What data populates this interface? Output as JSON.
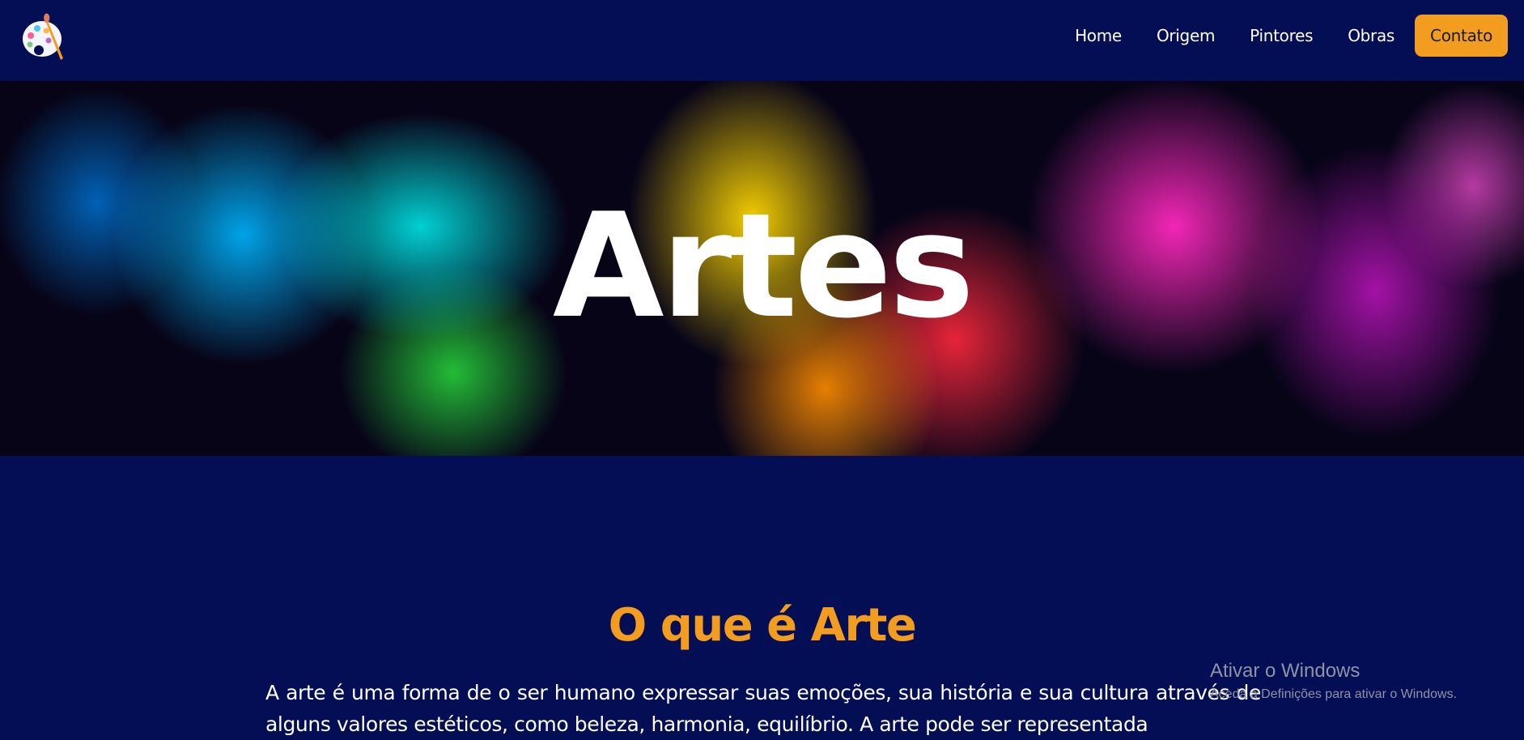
{
  "nav": {
    "items": [
      {
        "label": "Home"
      },
      {
        "label": "Origem"
      },
      {
        "label": "Pintores"
      },
      {
        "label": "Obras"
      }
    ],
    "cta_label": "Contato",
    "logo_icon": "palette-icon"
  },
  "hero": {
    "title": "Artes"
  },
  "section": {
    "title": "O que é Arte",
    "text": "A arte é uma forma de o ser humano expressar suas emoções, sua história e sua cultura através de alguns valores estéticos, como beleza, harmonia, equilíbrio. A arte pode ser representada"
  },
  "watermark": {
    "title": "Ativar o Windows",
    "subtitle": "Aceda a Definições para ativar o Windows."
  },
  "colors": {
    "background": "#030e55",
    "accent": "#f29d1f",
    "text": "#ffffff"
  }
}
